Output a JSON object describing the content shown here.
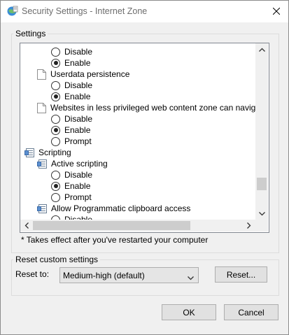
{
  "window": {
    "title": "Security Settings - Internet Zone"
  },
  "settings_group": {
    "label": "Settings",
    "items": [
      {
        "kind": "radio",
        "label": "Disable",
        "checked": false
      },
      {
        "kind": "radio",
        "label": "Enable",
        "checked": true
      },
      {
        "kind": "setting",
        "label": "Userdata persistence"
      },
      {
        "kind": "radio",
        "label": "Disable",
        "checked": false
      },
      {
        "kind": "radio",
        "label": "Enable",
        "checked": true
      },
      {
        "kind": "setting",
        "label": "Websites in less privileged web content zone can navigate in"
      },
      {
        "kind": "radio",
        "label": "Disable",
        "checked": false
      },
      {
        "kind": "radio",
        "label": "Enable",
        "checked": true
      },
      {
        "kind": "radio",
        "label": "Prompt",
        "checked": false
      },
      {
        "kind": "category",
        "label": "Scripting"
      },
      {
        "kind": "subcategory",
        "label": "Active scripting"
      },
      {
        "kind": "radio",
        "label": "Disable",
        "checked": false
      },
      {
        "kind": "radio",
        "label": "Enable",
        "checked": true
      },
      {
        "kind": "radio",
        "label": "Prompt",
        "checked": false
      },
      {
        "kind": "subcategory",
        "label": "Allow Programmatic clipboard access"
      },
      {
        "kind": "radio",
        "label": "Disable",
        "checked": false
      }
    ],
    "note": "* Takes effect after you've restarted your computer"
  },
  "reset_group": {
    "label": "Reset custom settings",
    "reset_to_label": "Reset to:",
    "selected_level": "Medium-high (default)",
    "reset_button": "Reset..."
  },
  "footer": {
    "ok": "OK",
    "cancel": "Cancel"
  },
  "icons": {
    "app": "internet-options-icon",
    "close": "close-icon",
    "page": "page-icon",
    "settings": "settings-category-icon"
  }
}
